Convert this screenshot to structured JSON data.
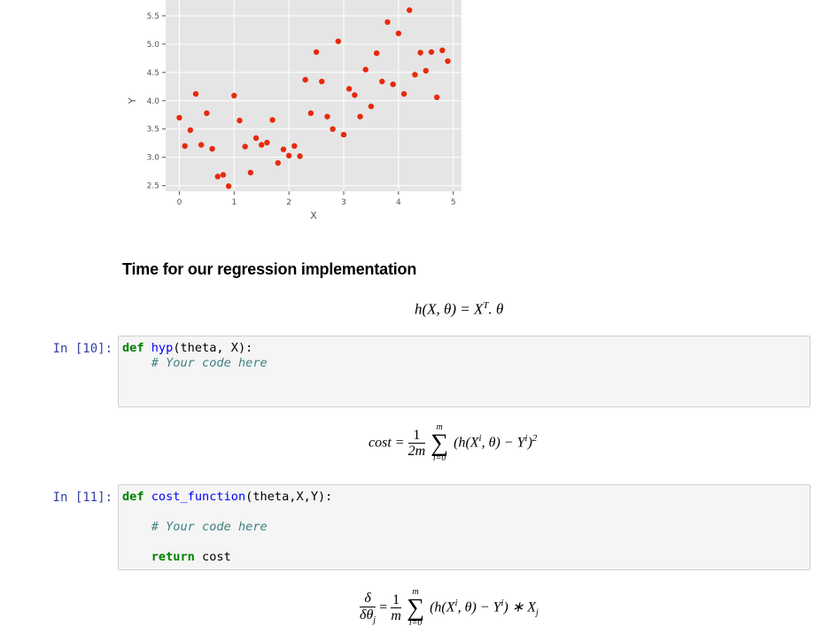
{
  "chart_data": {
    "type": "scatter",
    "xlabel": "X",
    "ylabel": "Y",
    "xlim": [
      -0.25,
      5.15
    ],
    "ylim": [
      2.4,
      5.78
    ],
    "x_ticks": [
      0,
      1,
      2,
      3,
      4,
      5
    ],
    "y_ticks": [
      2.5,
      3.0,
      3.5,
      4.0,
      4.5,
      5.0,
      5.5
    ],
    "y_tick_labels": [
      "2.5",
      "3.0",
      "3.5",
      "4.0",
      "4.5",
      "5.0",
      "5.5"
    ],
    "background": "#e5e5e5",
    "grid_color": "#ffffff",
    "point_color": "#e8290b",
    "grid": true,
    "points": [
      [
        0.0,
        3.7
      ],
      [
        0.1,
        3.2
      ],
      [
        0.2,
        3.48
      ],
      [
        0.3,
        4.12
      ],
      [
        0.4,
        3.22
      ],
      [
        0.5,
        3.78
      ],
      [
        0.6,
        3.15
      ],
      [
        0.7,
        2.66
      ],
      [
        0.8,
        2.69
      ],
      [
        0.9,
        2.49
      ],
      [
        1.0,
        4.09
      ],
      [
        1.1,
        3.65
      ],
      [
        1.2,
        3.19
      ],
      [
        1.3,
        2.73
      ],
      [
        1.4,
        3.34
      ],
      [
        1.5,
        3.22
      ],
      [
        1.6,
        3.26
      ],
      [
        1.7,
        3.66
      ],
      [
        1.8,
        2.9
      ],
      [
        1.9,
        3.14
      ],
      [
        2.0,
        3.03
      ],
      [
        2.1,
        3.2
      ],
      [
        2.2,
        3.02
      ],
      [
        2.3,
        4.37
      ],
      [
        2.4,
        3.78
      ],
      [
        2.5,
        4.86
      ],
      [
        2.6,
        4.34
      ],
      [
        2.7,
        3.72
      ],
      [
        2.8,
        3.5
      ],
      [
        2.9,
        5.05
      ],
      [
        3.0,
        3.4
      ],
      [
        3.1,
        4.21
      ],
      [
        3.2,
        4.1
      ],
      [
        3.3,
        3.72
      ],
      [
        3.4,
        4.55
      ],
      [
        3.5,
        3.9
      ],
      [
        3.6,
        4.84
      ],
      [
        3.7,
        4.34
      ],
      [
        3.8,
        5.39
      ],
      [
        3.9,
        4.29
      ],
      [
        4.0,
        5.19
      ],
      [
        4.1,
        4.12
      ],
      [
        4.2,
        5.6
      ],
      [
        4.3,
        4.46
      ],
      [
        4.4,
        4.85
      ],
      [
        4.5,
        4.53
      ],
      [
        4.6,
        4.86
      ],
      [
        4.7,
        4.06
      ],
      [
        4.8,
        4.89
      ],
      [
        4.9,
        4.7
      ]
    ]
  },
  "markdown": {
    "heading": "Time for our regression implementation",
    "eq_hyp": {
      "lhs": "h(X, θ) = X",
      "sup": "T",
      "rhs": ". θ"
    },
    "eq_cost": {
      "lhs": "cost =",
      "frac_num": "1",
      "frac_den": "2m",
      "sum_top": "m",
      "sum_bot": "i=0",
      "body_a": "(h(X",
      "sup_i1": "i",
      "body_b": ", θ) − Y",
      "sup_i2": "i",
      "body_c": ")",
      "sup_2": "2"
    },
    "eq_grad": {
      "lhs_num": "δ",
      "lhs_den": "δθ",
      "lhs_den_sub": "j",
      "eq": "=",
      "frac_num": "1",
      "frac_den": "m",
      "sum_top": "m",
      "sum_bot": "i=0",
      "body_a": "(h(X",
      "sup_i1": "i",
      "body_b": ", θ) − Y",
      "sup_i2": "i",
      "body_c": ") ∗ X",
      "sub_j": "j"
    }
  },
  "cells": [
    {
      "prompt": "In [10]:",
      "line1_kw": "def",
      "line1_fn": "hyp",
      "line1_rest": "(theta, X):",
      "line2_comment": "    # Your code here"
    },
    {
      "prompt": "In [11]:",
      "line1_kw": "def",
      "line1_fn": "cost_function",
      "line1_rest": "(theta,X,Y):",
      "line2_comment": "    # Your code here",
      "line3_indent": "    ",
      "line3_kw": "return",
      "line3_rest": " cost"
    }
  ]
}
